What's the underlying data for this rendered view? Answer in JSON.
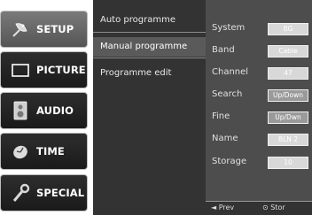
{
  "sidebar": {
    "items": [
      {
        "label": "SETUP",
        "icon": "satellite-dish-icon"
      },
      {
        "label": "PICTURE",
        "icon": "tv-screen-icon"
      },
      {
        "label": "AUDIO",
        "icon": "speaker-icon"
      },
      {
        "label": "TIME",
        "icon": "clock-icon"
      },
      {
        "label": "SPECIAL",
        "icon": "tools-icon"
      }
    ]
  },
  "submenu": {
    "items": [
      "Auto programme",
      "Manual programme",
      "Programme edit"
    ],
    "selected": "Manual programme"
  },
  "settings": {
    "rows": [
      {
        "label": "System",
        "value": "BG"
      },
      {
        "label": "Band",
        "value": "Cable"
      },
      {
        "label": "Channel",
        "value": "47"
      },
      {
        "label": "Search",
        "value": "Up/Down"
      },
      {
        "label": "Fine",
        "value": "Up/Dwn"
      },
      {
        "label": "Name",
        "value": "BLN 2"
      },
      {
        "label": "Storage",
        "value": "10"
      }
    ]
  },
  "hints": {
    "prev": "◄ Prev",
    "store": "⊙ Stor"
  },
  "colors": {
    "tab_bg": "#1f1f1f",
    "tab_active_bg": "#6a6a6a",
    "panel_bg": "#4a4a4a",
    "value_box": "#d8d8d8"
  }
}
